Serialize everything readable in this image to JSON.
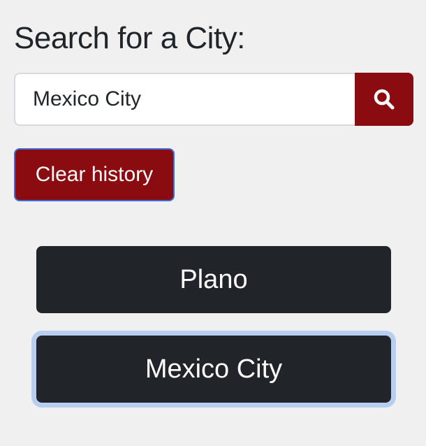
{
  "search": {
    "heading": "Search for a City:",
    "input_value": "Mexico City",
    "search_icon": "search-icon"
  },
  "actions": {
    "clear_label": "Clear history"
  },
  "history": {
    "items": [
      {
        "label": "Plano"
      },
      {
        "label": "Mexico City"
      }
    ]
  },
  "colors": {
    "accent": "#8b0c10",
    "history_button": "#212429",
    "focus_ring": "#b8cef0",
    "background": "#f0f0f0"
  }
}
